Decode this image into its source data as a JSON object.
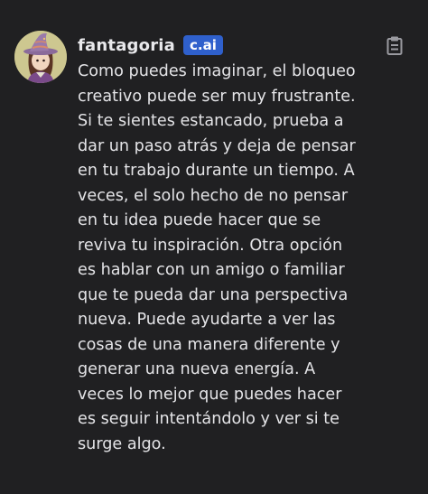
{
  "message": {
    "author": "fantagoria",
    "badge": "c.ai",
    "copy_icon": "clipboard-icon",
    "avatar_icon": "witch-avatar",
    "lines": [
      "Como puedes imaginar, el bloqueo",
      "creativo puede ser muy frustrante.",
      "Si te sientes estancado, prueba a",
      "dar un paso atrás y deja de pensar",
      "en tu trabajo durante un tiempo. A",
      "veces, el solo hecho de no pensar",
      "en tu idea puede hacer que se",
      "reviva tu inspiración. Otra opción",
      "es hablar con un amigo o familiar",
      "que te pueda dar una perspectiva",
      "nueva. Puede ayudarte a ver las",
      "cosas de una manera diferente y",
      "generar una nueva energía. A",
      "veces lo mejor que puedes hacer",
      "es seguir intentándolo y ver si te",
      "surge algo."
    ]
  },
  "colors": {
    "background": "#202022",
    "badge": "#2f60cc",
    "text": "#e4e4e7"
  }
}
